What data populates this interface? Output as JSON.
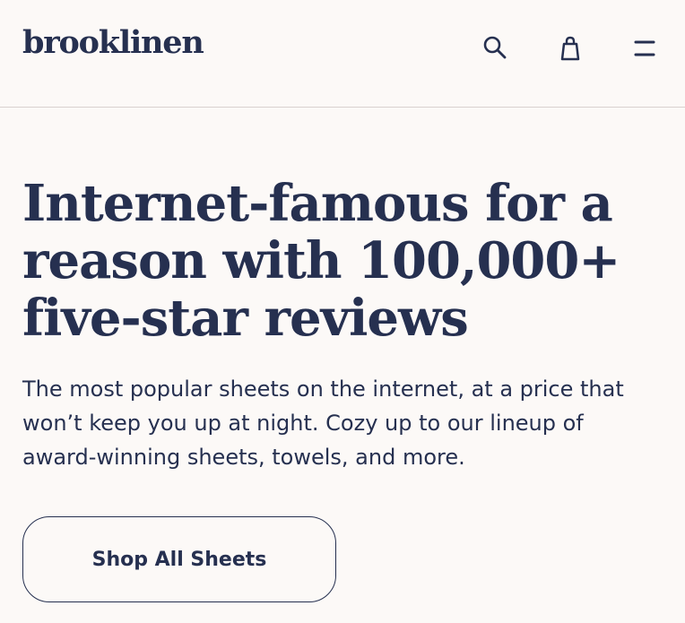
{
  "header": {
    "logo_text": "brooklinen",
    "icons": {
      "search": "search-icon",
      "bag": "shopping-bag-icon",
      "menu": "menu-icon"
    }
  },
  "hero": {
    "title": "Internet-famous for a reason with 100,000+ five-star reviews",
    "description": "The most popular sheets on the internet, at a price that won’t keep you up at night. Cozy up to our lineup of award-winning sheets, towels, and more.",
    "cta_label": "Shop All Sheets"
  },
  "colors": {
    "background": "#fcf9f7",
    "text": "#263050",
    "divider": "#d8d2cf"
  }
}
